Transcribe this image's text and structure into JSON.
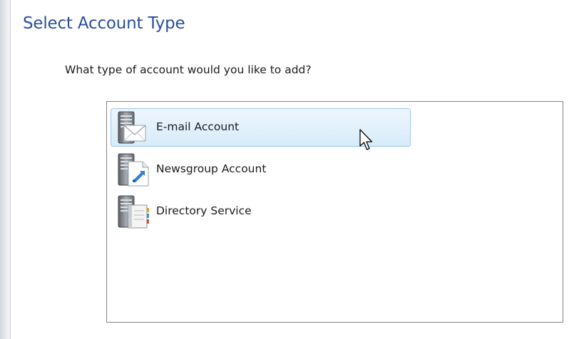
{
  "dialog": {
    "title": "Select Account Type",
    "question": "What type of account would you like to add?"
  },
  "account_types": [
    {
      "label": "E-mail Account",
      "icon": "email-server-icon",
      "selected": true
    },
    {
      "label": "Newsgroup Account",
      "icon": "newsgroup-server-icon",
      "selected": false
    },
    {
      "label": "Directory Service",
      "icon": "directory-server-icon",
      "selected": false
    }
  ],
  "colors": {
    "title": "#2a4f9a",
    "selection_border": "#9dc7ec",
    "selection_fill": "#d7ebfa",
    "list_border": "#848484"
  }
}
